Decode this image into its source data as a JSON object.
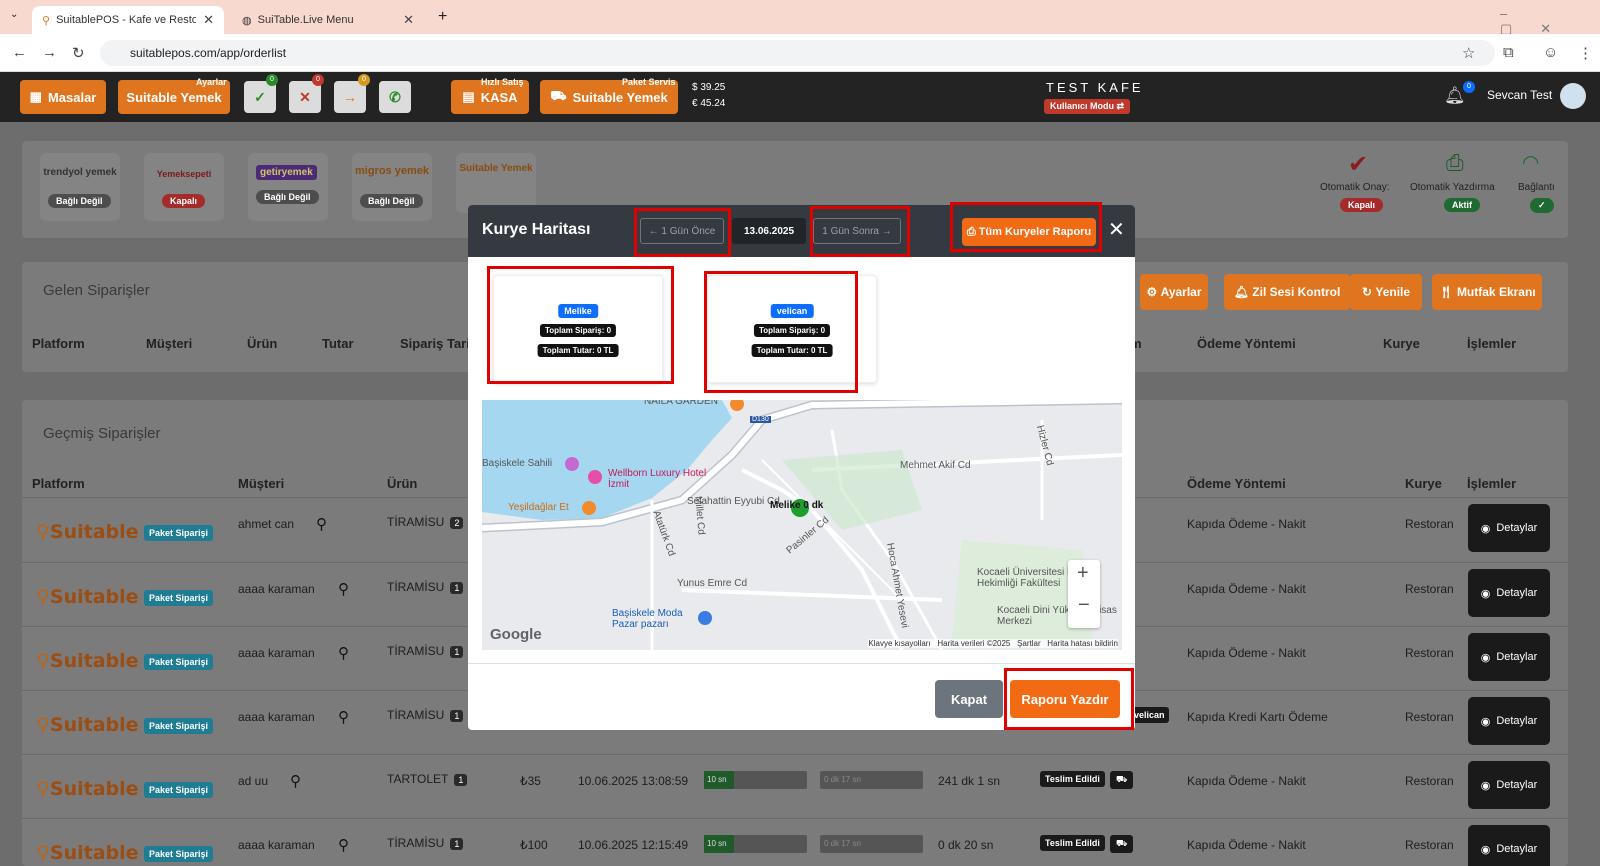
{
  "browser": {
    "tab1": "SuitablePOS - Kafe ve Restoran",
    "tab2": "SuiTable.Live Menu",
    "url": "suitablepos.com/app/orderlist"
  },
  "topbar": {
    "masalar": "Masalar",
    "ayarlar_tag": "Ayarlar",
    "suitable_yemek": "Suitable Yemek",
    "badge_a": "0",
    "badge_b": "0",
    "badge_c": "0",
    "hizli_satis_tag": "Hızlı Satış",
    "kasa": "KASA",
    "paket_servis_tag": "Paket Servis",
    "suitable_yemek2": "Suitable Yemek",
    "usd": "$  39.25",
    "eur": "€  45.24",
    "cafe_name": "TEST KAFE",
    "mode": "Kullanıcı Modu",
    "notif": "0",
    "user": "Sevcan Test"
  },
  "platforms": [
    {
      "name": "trendyol yemek",
      "status": "Bağlı Değil"
    },
    {
      "name": "Yemeksepeti",
      "status": "Kapalı"
    },
    {
      "name": "getiryemek",
      "status": "Bağlı Değil"
    },
    {
      "name": "migros yemek",
      "status": "Bağlı Değil"
    },
    {
      "name": "Suitable Yemek",
      "status": ""
    }
  ],
  "status_panel": {
    "oto_onay": "Otomatik Onay:",
    "oto_onay_val": "Kapalı",
    "oto_yazdirma": "Otomatik Yazdırma",
    "oto_yazdirma_val": "Aktif",
    "baglanti": "Bağlantı"
  },
  "incoming": {
    "title": "Gelen Siparişler",
    "buttons": [
      "Ayarlar",
      "Zil Sesi Kontrol",
      "Yenile",
      "Mutfak Ekranı"
    ],
    "headers": [
      "Platform",
      "Müşteri",
      "Ürün",
      "Tutar",
      "Sipariş Tarih",
      "m",
      "Ödeme Yöntemi",
      "Kurye",
      "İşlemler"
    ]
  },
  "past": {
    "title": "Geçmiş Siparişler",
    "headers": [
      "Platform",
      "Müşteri",
      "Ürün",
      "Ödeme Yöntemi",
      "Kurye",
      "İşlemler"
    ],
    "logo": "Suitable",
    "paket": "Paket Siparişi",
    "detail": "Detaylar",
    "rows": [
      {
        "customer": "ahmet can",
        "product": "TİRAMİSU",
        "qty": "2",
        "amount": "",
        "date": "",
        "t1": "",
        "t2": "",
        "dur": "",
        "status": "",
        "payment": "Kapıda Ödeme - Nakit",
        "courier": "Restoran"
      },
      {
        "customer": "aaaa karaman",
        "product": "TİRAMİSU",
        "qty": "1",
        "amount": "",
        "date": "",
        "t1": "",
        "t2": "",
        "dur": "",
        "status": "",
        "payment": "Kapıda Ödeme - Nakit",
        "courier": "Restoran"
      },
      {
        "customer": "aaaa karaman",
        "product": "TİRAMİSU",
        "qty": "1",
        "amount": "",
        "date": "",
        "t1": "",
        "t2": "",
        "dur": "",
        "status": "",
        "payment": "Kapıda Ödeme - Nakit",
        "courier": "Restoran"
      },
      {
        "customer": "aaaa karaman",
        "product": "TİRAMİSU",
        "qty": "1",
        "amount": "",
        "date": "",
        "t1": "",
        "t2": "",
        "dur": "",
        "status": "velican",
        "payment": "Kapıda Kredi Kartı Ödeme",
        "courier": "Restoran"
      },
      {
        "customer": "ad uu",
        "product": "TARTOLET",
        "qty": "1",
        "amount": "₺35",
        "date": "10.06.2025 13:08:59",
        "t1": "10 sn",
        "t2": "0 dk 17 sn",
        "dur": "241 dk 1 sn",
        "status": "Teslim Edildi",
        "payment": "Kapıda Ödeme - Nakit",
        "courier": "Restoran"
      },
      {
        "customer": "aaaa karaman",
        "product": "TİRAMİSU",
        "qty": "1",
        "amount": "₺100",
        "date": "10.06.2025 12:15:49",
        "t1": "10 sn",
        "t2": "0 dk 17 sn",
        "dur": "0 dk 20 sn",
        "status": "Teslim Edildi",
        "payment": "Kapıda Ödeme - Nakit",
        "courier": "Restoran"
      }
    ]
  },
  "modal": {
    "title": "Kurye Haritası",
    "prev": "← 1 Gün Önce",
    "date": "13.06.2025",
    "next": "1 Gün Sonra →",
    "report_all": "Tüm Kuryeler Raporu",
    "couriers": [
      {
        "name": "Melike",
        "orders": "Toplam Sipariş: 0",
        "total": "Toplam Tutar: 0 TL"
      },
      {
        "name": "velican",
        "orders": "Toplam Sipariş: 0",
        "total": "Toplam Tutar: 0 TL"
      }
    ],
    "map": {
      "labels": [
        "NAİLA GARDEN",
        "Başiskele Sahili",
        "Wellborn Luxury Hotel İzmit",
        "Yeşildağlar Et",
        "Mehmet Akif Cd",
        "Selahattin Eyyubi Cd",
        "Yunus Emre Cd",
        "Kocaeli Üniversitesi Diş Hekimliği Fakültesi",
        "Kocaeli Dini Yüksek İhtisas Merkezi",
        "Başiskele Moda Pazar pazarı",
        "Hizler Cd",
        "Atatürk Cd",
        "Millet Cd",
        "Pasinler Cd",
        "Hoca Ahmet Yesevi",
        "D130",
        "Melike 0 dk"
      ],
      "google": "Google",
      "footer": [
        "Klavye kısayolları",
        "Harita verileri ©2025",
        "Şartlar",
        "Harita hatası bildirin"
      ]
    },
    "close": "Kapat",
    "print": "Raporu Yazdır"
  }
}
